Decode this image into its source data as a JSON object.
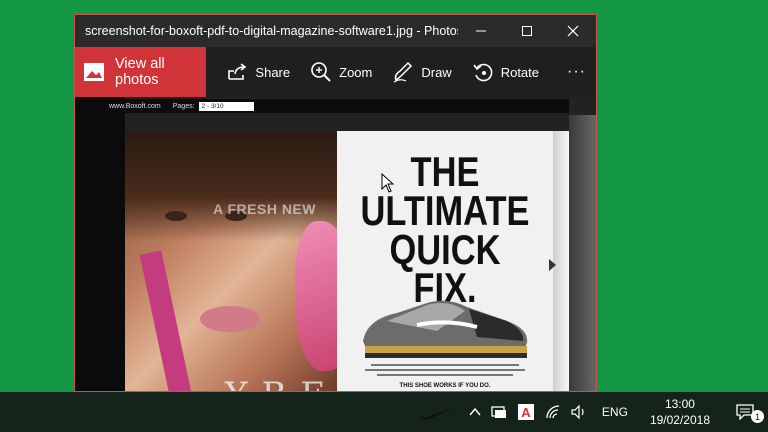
{
  "window": {
    "title": "screenshot-for-boxoft-pdf-to-digital-magazine-software1.jpg - Photos",
    "controls": {
      "minimize": "minimize-icon",
      "maximize": "maximize-icon",
      "close": "close-icon"
    }
  },
  "toolbar": {
    "view_all_label": "View all photos",
    "share_label": "Share",
    "zoom_label": "Zoom",
    "draw_label": "Draw",
    "rotate_label": "Rotate",
    "more_label": "···"
  },
  "image": {
    "site": "www.Boxoft.com",
    "pages_label": "Pages:",
    "pages_value": "2 - 3/10",
    "fresh_text": "A FRESH NEW",
    "brand_text": "YBE",
    "headline_1": "THE",
    "headline_2": "ULTIMATE",
    "headline_3": "QUICK FIX.",
    "tagline": "THIS SHOE WORKS IF YOU DO."
  },
  "taskbar": {
    "language": "ENG",
    "time": "13:00",
    "date": "19/02/2018",
    "notification_count": "1"
  },
  "colors": {
    "desktop": "#149744",
    "accent": "#d13438",
    "toolbar": "#1f1f1f",
    "titlebar": "#2b2b2b"
  }
}
